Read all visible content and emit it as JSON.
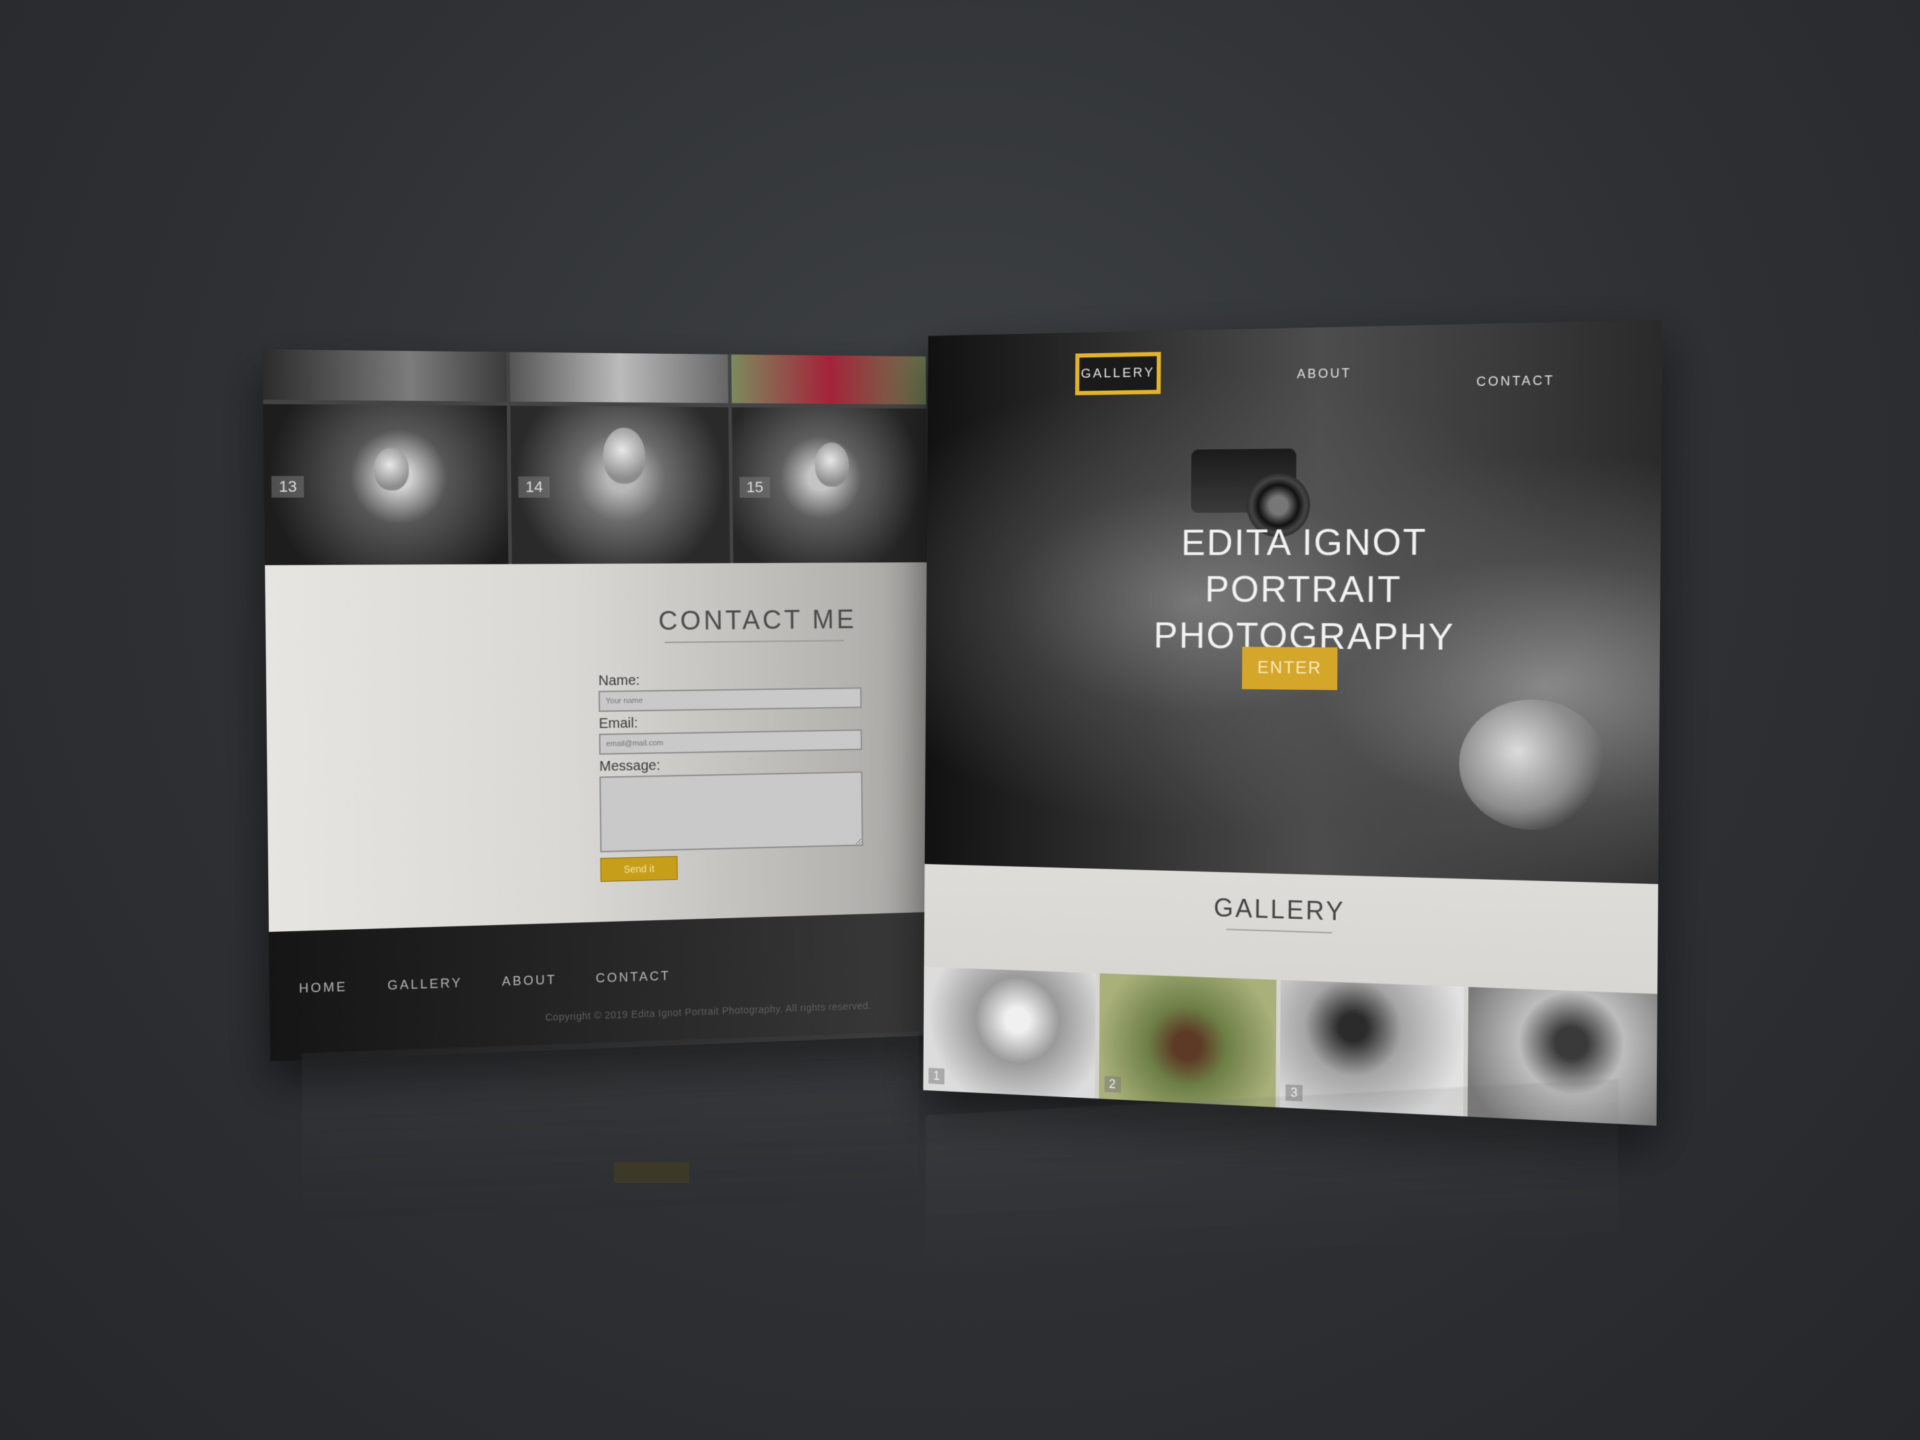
{
  "left_screen": {
    "thumbnails": [
      {
        "num": "13"
      },
      {
        "num": "14"
      },
      {
        "num": "15"
      }
    ],
    "contact": {
      "title": "CONTACT ME",
      "name_label": "Name:",
      "name_placeholder": "Your name",
      "email_label": "Email:",
      "email_placeholder": "email@mail.com",
      "message_label": "Message:",
      "send_label": "Send it"
    },
    "footer": {
      "nav": [
        "HOME",
        "GALLERY",
        "ABOUT",
        "CONTACT"
      ],
      "copyright": "Copyright © 2019 Edita Ignot Portrait Photography. All rights reserved."
    }
  },
  "right_screen": {
    "nav": {
      "gallery": "GALLERY",
      "about": "ABOUT",
      "contact": "CONTACT"
    },
    "hero": {
      "title_line1": "EDITA IGNOT",
      "title_line2": "PORTRAIT PHOTOGRAPHY",
      "enter_label": "ENTER"
    },
    "gallery": {
      "title": "GALLERY",
      "items": [
        {
          "num": "1"
        },
        {
          "num": "2"
        },
        {
          "num": "3"
        },
        {
          "num": ""
        }
      ]
    }
  },
  "colors": {
    "accent_gold": "#d4a72a",
    "background": "#2e3033"
  },
  "icons": []
}
